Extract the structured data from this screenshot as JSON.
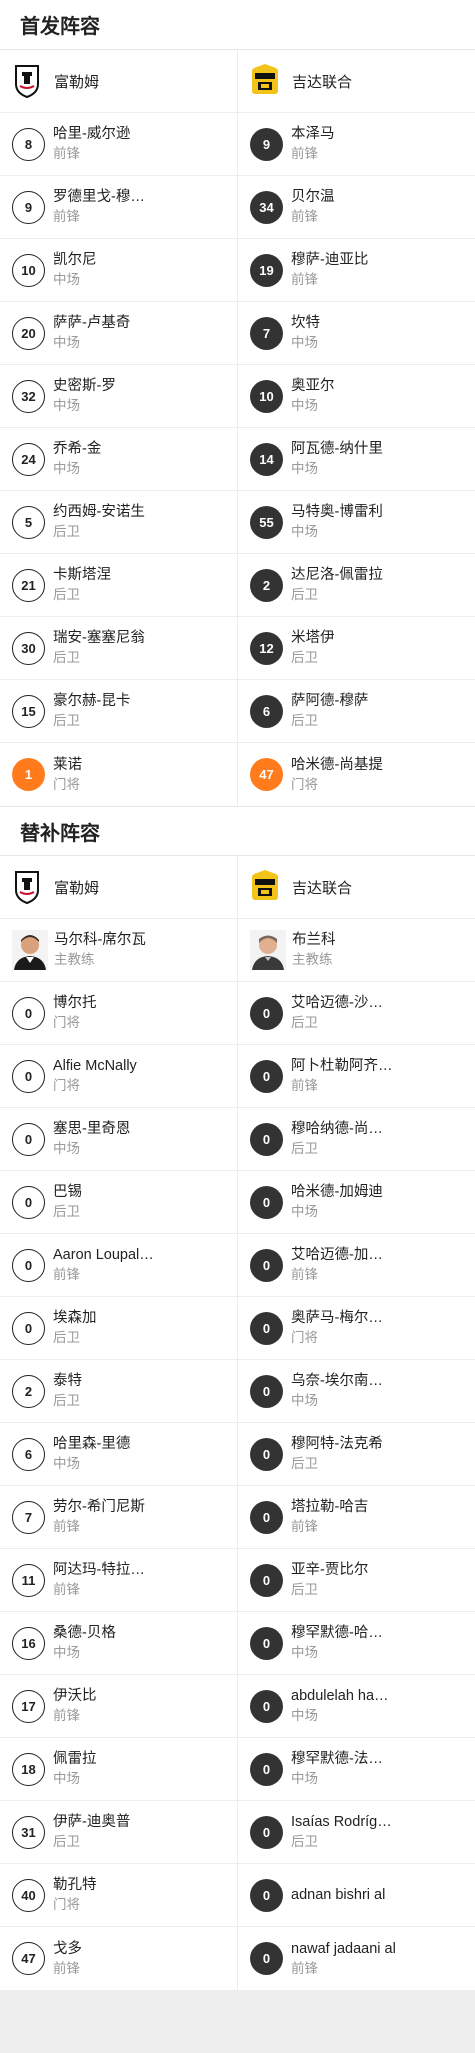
{
  "starting": {
    "title": "首发阵容",
    "home": {
      "team": "富勒姆",
      "players": [
        {
          "num": "8",
          "name": "哈里-威尔逊",
          "pos": "前锋"
        },
        {
          "num": "9",
          "name": "罗德里戈-穆…",
          "pos": "前锋"
        },
        {
          "num": "10",
          "name": "凯尔尼",
          "pos": "中场"
        },
        {
          "num": "20",
          "name": "萨萨-卢基奇",
          "pos": "中场"
        },
        {
          "num": "32",
          "name": "史密斯-罗",
          "pos": "中场"
        },
        {
          "num": "24",
          "name": "乔希-金",
          "pos": "中场"
        },
        {
          "num": "5",
          "name": "约西姆-安诺生",
          "pos": "后卫"
        },
        {
          "num": "21",
          "name": "卡斯塔涅",
          "pos": "后卫"
        },
        {
          "num": "30",
          "name": "瑞安-塞塞尼翁",
          "pos": "后卫"
        },
        {
          "num": "15",
          "name": "豪尔赫-昆卡",
          "pos": "后卫"
        },
        {
          "num": "1",
          "name": "莱诺",
          "pos": "门将",
          "gk": true
        }
      ]
    },
    "away": {
      "team": "吉达联合",
      "players": [
        {
          "num": "9",
          "name": "本泽马",
          "pos": "前锋"
        },
        {
          "num": "34",
          "name": "贝尔温",
          "pos": "前锋"
        },
        {
          "num": "19",
          "name": "穆萨-迪亚比",
          "pos": "前锋"
        },
        {
          "num": "7",
          "name": "坎特",
          "pos": "中场"
        },
        {
          "num": "10",
          "name": "奥亚尔",
          "pos": "中场"
        },
        {
          "num": "14",
          "name": "阿瓦德-纳什里",
          "pos": "中场"
        },
        {
          "num": "55",
          "name": "马特奥-博雷利",
          "pos": "中场"
        },
        {
          "num": "2",
          "name": "达尼洛-佩雷拉",
          "pos": "后卫"
        },
        {
          "num": "12",
          "name": "米塔伊",
          "pos": "后卫"
        },
        {
          "num": "6",
          "name": "萨阿德-穆萨",
          "pos": "后卫"
        },
        {
          "num": "47",
          "name": "哈米德-尚基提",
          "pos": "门将",
          "gk": true
        }
      ]
    }
  },
  "subs": {
    "title": "替补阵容",
    "home": {
      "team": "富勒姆",
      "coach": {
        "name": "马尔科-席尔瓦",
        "role": "主教练"
      },
      "players": [
        {
          "num": "0",
          "name": "博尔托",
          "pos": "门将"
        },
        {
          "num": "0",
          "name": "Alfie McNally",
          "pos": "门将"
        },
        {
          "num": "0",
          "name": "塞思-里奇恩",
          "pos": "中场"
        },
        {
          "num": "0",
          "name": "巴锡",
          "pos": "后卫"
        },
        {
          "num": "0",
          "name": "Aaron Loupal…",
          "pos": "前锋"
        },
        {
          "num": "0",
          "name": "埃森加",
          "pos": "后卫"
        },
        {
          "num": "2",
          "name": "泰特",
          "pos": "后卫"
        },
        {
          "num": "6",
          "name": "哈里森-里德",
          "pos": "中场"
        },
        {
          "num": "7",
          "name": "劳尔-希门尼斯",
          "pos": "前锋"
        },
        {
          "num": "11",
          "name": "阿达玛-特拉…",
          "pos": "前锋"
        },
        {
          "num": "16",
          "name": "桑德-贝格",
          "pos": "中场"
        },
        {
          "num": "17",
          "name": "伊沃比",
          "pos": "前锋"
        },
        {
          "num": "18",
          "name": "佩雷拉",
          "pos": "中场"
        },
        {
          "num": "31",
          "name": "伊萨-迪奥普",
          "pos": "后卫"
        },
        {
          "num": "40",
          "name": "勒孔特",
          "pos": "门将"
        },
        {
          "num": "47",
          "name": "戈多",
          "pos": "前锋"
        }
      ]
    },
    "away": {
      "team": "吉达联合",
      "coach": {
        "name": "布兰科",
        "role": "主教练"
      },
      "players": [
        {
          "num": "0",
          "name": "艾哈迈德-沙…",
          "pos": "后卫"
        },
        {
          "num": "0",
          "name": "阿卜杜勒阿齐…",
          "pos": "前锋"
        },
        {
          "num": "0",
          "name": "穆哈纳德-尚…",
          "pos": "后卫"
        },
        {
          "num": "0",
          "name": "哈米德-加姆迪",
          "pos": "中场"
        },
        {
          "num": "0",
          "name": "艾哈迈德-加…",
          "pos": "前锋"
        },
        {
          "num": "0",
          "name": "奥萨马-梅尔…",
          "pos": "门将"
        },
        {
          "num": "0",
          "name": "乌奈-埃尔南…",
          "pos": "中场"
        },
        {
          "num": "0",
          "name": "穆阿特-法克希",
          "pos": "后卫"
        },
        {
          "num": "0",
          "name": "塔拉勒-哈吉",
          "pos": "前锋"
        },
        {
          "num": "0",
          "name": "亚辛-贾比尔",
          "pos": "后卫"
        },
        {
          "num": "0",
          "name": "穆罕默德-哈…",
          "pos": "中场"
        },
        {
          "num": "0",
          "name": "abdulelah ha…",
          "pos": "中场"
        },
        {
          "num": "0",
          "name": "穆罕默德-法…",
          "pos": "中场"
        },
        {
          "num": "0",
          "name": "Isaías Rodríg…",
          "pos": "后卫"
        },
        {
          "num": "0",
          "name": "adnan bishri al",
          "pos": ""
        },
        {
          "num": "0",
          "name": "nawaf jadaani al",
          "pos": "前锋"
        }
      ]
    }
  },
  "colors": {
    "goalkeeper": "#ff7b1c",
    "away_badge": "#333333",
    "fulham_logo": "#111111",
    "ittihad_logo": "#f2c318"
  },
  "icons": {
    "home_logo": "fulham-crest-icon",
    "away_logo": "al-ittihad-crest-icon"
  }
}
